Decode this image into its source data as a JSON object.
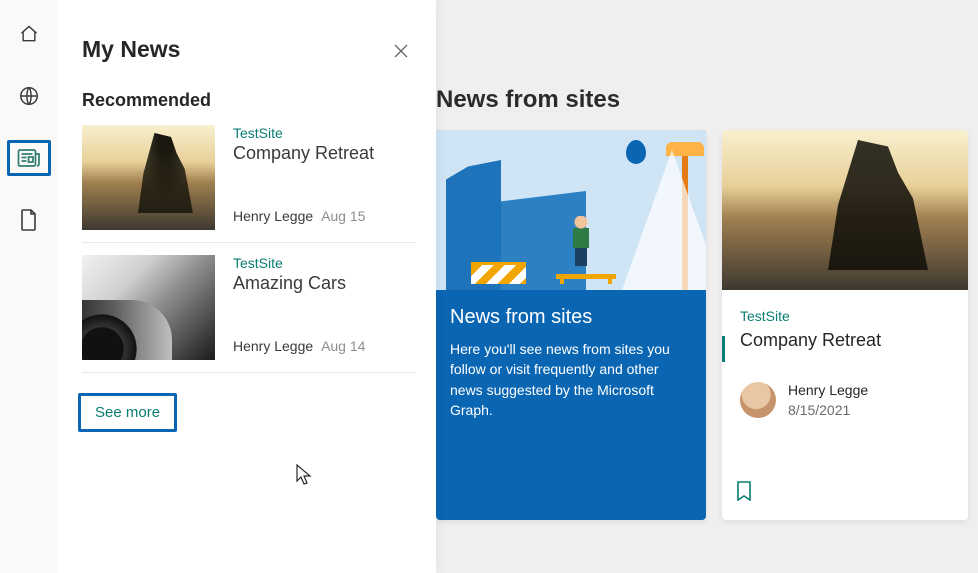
{
  "nav": {
    "home_icon": "home",
    "globe_icon": "globe",
    "news_icon": "news",
    "file_icon": "file"
  },
  "panel": {
    "title": "My News",
    "section_label": "Recommended",
    "see_more": "See more",
    "items": [
      {
        "site": "TestSite",
        "title": "Company Retreat",
        "author": "Henry Legge",
        "date": "Aug 15"
      },
      {
        "site": "TestSite",
        "title": "Amazing Cars",
        "author": "Henry Legge",
        "date": "Aug 14"
      }
    ]
  },
  "main": {
    "heading": "News from sites",
    "info_card": {
      "title": "News from sites",
      "text": "Here you'll see news from sites you follow or visit frequently and other news suggested by the Microsoft Graph."
    },
    "story_card": {
      "site": "TestSite",
      "title": "Company Retreat",
      "author": "Henry Legge",
      "date": "8/15/2021"
    }
  }
}
